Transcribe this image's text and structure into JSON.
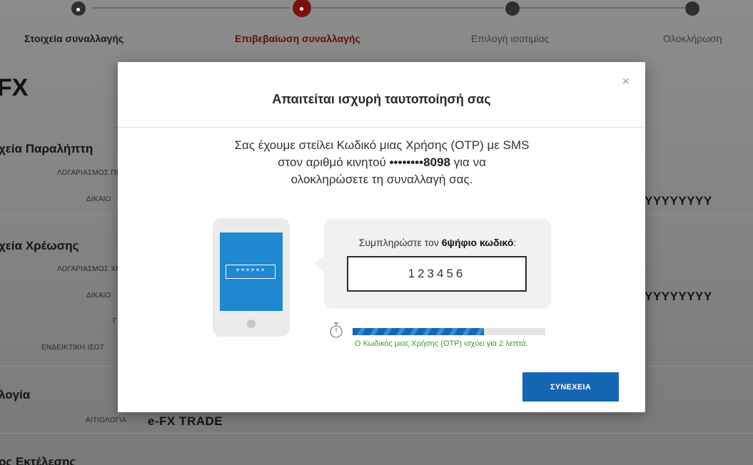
{
  "stepper": {
    "steps": [
      {
        "label": "Στοιχεία συναλλαγής",
        "state": "done"
      },
      {
        "label": "Επιβεβαίωση συναλλαγής",
        "state": "current"
      },
      {
        "label": "Επιλογή ισοτιμίας",
        "state": "todo"
      },
      {
        "label": "Ολοκλήρωση",
        "state": "todo"
      }
    ]
  },
  "background": {
    "page_title": "FX",
    "sections": [
      {
        "title": "χεία Παραλήπτη",
        "labels": [
          "ΛΟΓΑΡΙΑΣΜΟΣ ΠΙΣΤ",
          "ΔΙΚΑΙΟ"
        ],
        "value": "YYYYYYYY"
      },
      {
        "title": "χεία Χρέωσης",
        "labels": [
          "ΛΟΓΑΡΙΑΣΜΟΣ ΧΡΕ",
          "ΔΙΚΑΙΟ",
          "Γ",
          "ΕΝΔΕΙΚΤΙΚΗ ΙΣΟΤ"
        ],
        "value": "YYYYYYYY"
      },
      {
        "title": "λογία",
        "labels": [
          "ΑΙΤΙΟΛΟΓΙΑ"
        ],
        "value": "e-FX TRADE"
      },
      {
        "title": "ος Εκτέλεσης"
      }
    ]
  },
  "modal": {
    "title": "Απαιτείται ισχυρή ταυτοποίησή σας",
    "close_label": "×",
    "message_line1": "Σας έχουμε στείλει Κωδικό μιας Χρήσης (OTP) με SMS",
    "message_line2_prefix": "στον αριθμό κινητού ",
    "masked_number": "••••••••8098",
    "message_line2_suffix": " για να",
    "message_line3": "ολοκληρώσετε τη συναλλαγή σας.",
    "phone_password_mask": "******",
    "prompt_prefix": "Συμπληρώστε τον ",
    "prompt_bold": "6ψήφιο κωδικό",
    "prompt_suffix": ":",
    "otp_value": "123456",
    "progress_fraction": 0.68,
    "validity_note": "Ο Κωδικός μιας Χρήσης (OTP) ισχύει για 2 λεπτά.",
    "continue_label": "ΣΥΝΕΧΕΙΑ"
  },
  "colors": {
    "accent_red": "#6b0a0a",
    "primary_blue": "#1565b5",
    "success_green": "#3a9a3a"
  }
}
